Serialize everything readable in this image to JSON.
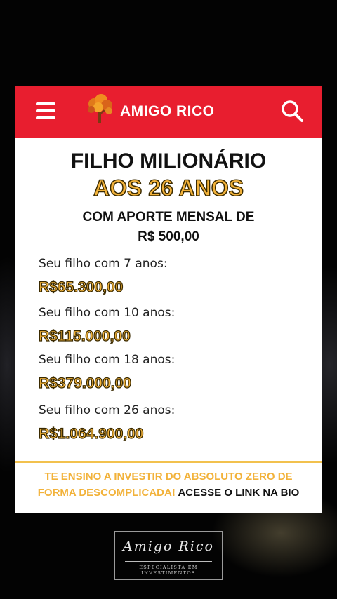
{
  "header": {
    "brand": "AMIGO RICO",
    "menu_icon": "hamburger-menu-icon",
    "search_icon": "search-icon",
    "logo_icon": "tree-logo-icon",
    "bar_color": "#e81e2f"
  },
  "hero": {
    "title_line1": "FILHO MILIONÁRIO",
    "title_line2": "AOS 26 ANOS",
    "subtitle_line1": "COM APORTE MENSAL DE",
    "subtitle_line2": "R$ 500,00"
  },
  "rows": [
    {
      "label": "Seu filho com 7 anos:",
      "value": "R$65.300,00"
    },
    {
      "label": "Seu filho com 10 anos:",
      "value": "R$115.000,00"
    },
    {
      "label": "Seu filho com 18 anos:",
      "value": "R$379.000,00"
    },
    {
      "label": "Seu filho com 26 anos:",
      "value": "R$1.064.900,00"
    }
  ],
  "cta": {
    "line1": "TE ENSINO A INVESTIR DO ABSOLUTO ZERO DE",
    "line2": "FORMA DESCOMPLICADA!",
    "link": "ACESSE O LINK NA BIO"
  },
  "signature": {
    "name": "Amigo Rico",
    "tagline": "ESPECIALISTA EM INVESTIMENTOS"
  },
  "colors": {
    "accent_gold": "#f2b23a",
    "card_bg": "#ffffff"
  }
}
